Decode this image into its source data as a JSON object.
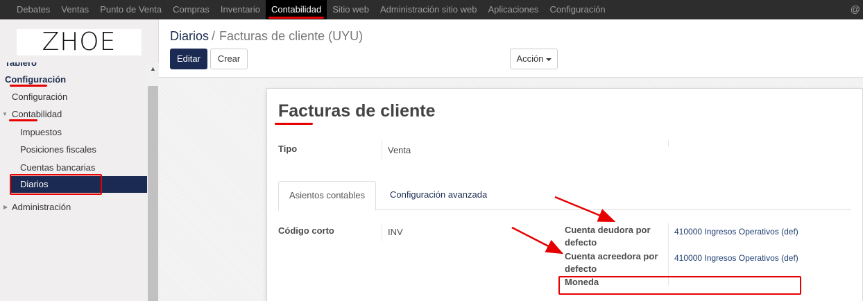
{
  "topbar": {
    "menu": [
      "Debates",
      "Ventas",
      "Punto de Venta",
      "Compras",
      "Inventario",
      "Contabilidad",
      "Sitio web",
      "Administración sitio web",
      "Aplicaciones",
      "Configuración"
    ],
    "active_index": 5,
    "user_icon": "at-icon"
  },
  "sidebar": {
    "logo": "ZHOE",
    "tablero": "Tablero",
    "section": "Configuración",
    "items": {
      "configuracion": "Configuración",
      "contabilidad": "Contabilidad",
      "impuestos": "Impuestos",
      "posiciones_fiscales": "Posiciones fiscales",
      "cuentas_bancarias": "Cuentas bancarias",
      "diarios": "Diarios",
      "administracion": "Administración"
    }
  },
  "header": {
    "breadcrumb_parent": "Diarios",
    "breadcrumb_separator": "/",
    "breadcrumb_current": "Facturas de cliente (UYU)",
    "edit_button": "Editar",
    "create_button": "Crear",
    "action_button": "Acción"
  },
  "form": {
    "title": "Facturas de cliente",
    "tipo_label": "Tipo",
    "tipo_value": "Venta",
    "tabs": [
      "Asientos contables",
      "Configuración avanzada"
    ],
    "active_tab": 0,
    "codigo_corto_label": "Código corto",
    "codigo_corto_value": "INV",
    "cuenta_deudora_label": "Cuenta deudora por defecto",
    "cuenta_deudora_value": "410000 Ingresos Operativos (def)",
    "cuenta_acreedora_label": "Cuenta acreedora por defecto",
    "cuenta_acreedora_value": "410000 Ingresos Operativos (def)",
    "moneda_label": "Moneda",
    "moneda_value": ""
  },
  "annotation_color": "#e60000"
}
